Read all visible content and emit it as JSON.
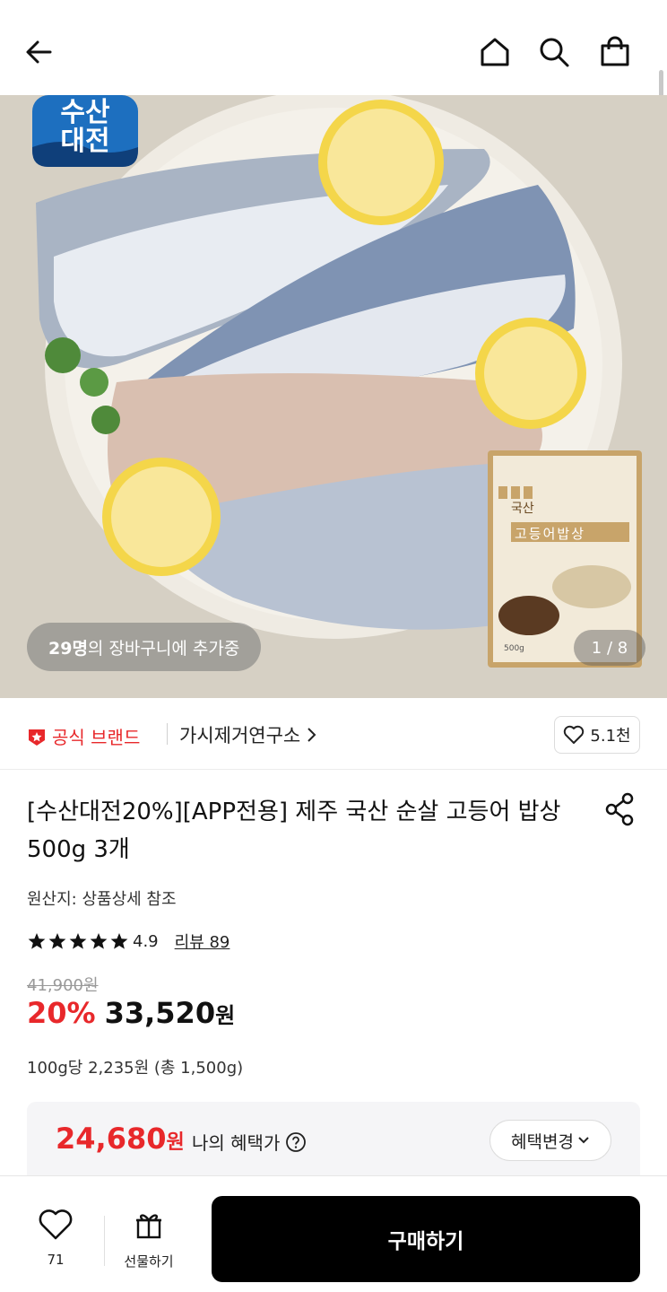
{
  "header": {
    "back_icon": "arrow-left-icon",
    "home_icon": "home-icon",
    "search_icon": "search-icon",
    "cart_icon": "shopping-bag-icon"
  },
  "hero": {
    "badge_text_line1": "수산",
    "badge_text_line2": "대전",
    "cart_count": "29명",
    "cart_text": "의 장바구니에 추가중",
    "pager": "1 / 8",
    "package_label_line1": "국산",
    "package_label_line2": "고등어밥상",
    "package_weight": "500g"
  },
  "brand": {
    "badge_label": "공식 브랜드",
    "name": "가시제거연구소",
    "like_count": "5.1천"
  },
  "product": {
    "title": "[수산대전20%][APP전용] 제주 국산 순살 고등어 밥상 500g 3개",
    "origin": "원산지: 상품상세 참조",
    "rating": "4.9",
    "stars": 5,
    "review_label": "리뷰 89",
    "original_price": "41,900원",
    "discount": "20%",
    "price": "33,520",
    "price_unit": "원",
    "unit_price": "100g당 2,235원 (총 1,500g)"
  },
  "benefit": {
    "price": "24,680",
    "price_unit": "원",
    "label": "나의 혜택가",
    "change_button": "혜택변경"
  },
  "bottom": {
    "wish_count": "71",
    "gift_label": "선물하기",
    "buy_label": "구매하기"
  },
  "colors": {
    "accent_red": "#e8282b",
    "buy_button": "#000000"
  }
}
